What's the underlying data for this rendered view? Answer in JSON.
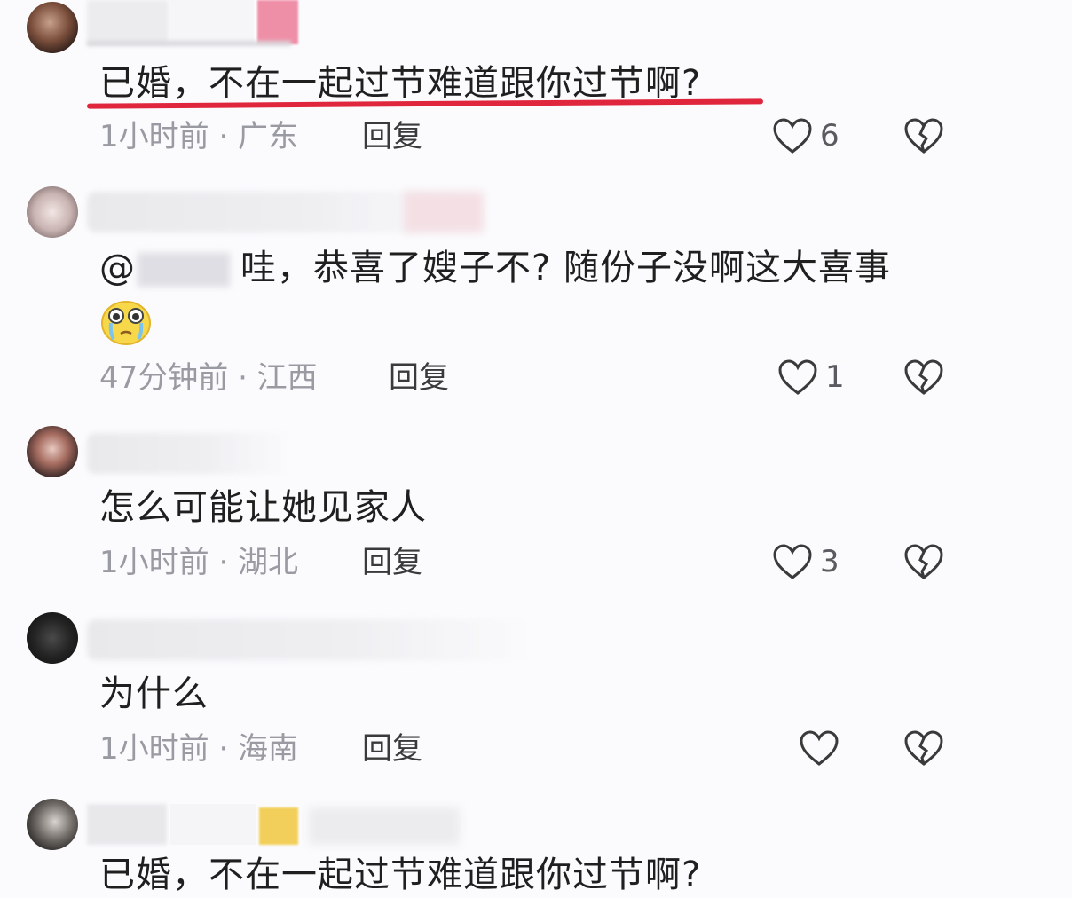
{
  "comments": [
    {
      "text": "已婚，不在一起过节难道跟你过节啊?",
      "time_location": "1小时前 · 广东",
      "reply_label": "回复",
      "likes": "6"
    },
    {
      "mention": "@",
      "text": "哇，恭喜了嫂子不? 随份子没啊这大喜事",
      "time_location": "47分钟前 · 江西",
      "reply_label": "回复",
      "likes": "1"
    },
    {
      "text": "怎么可能让她见家人",
      "time_location": "1小时前 · 湖北",
      "reply_label": "回复",
      "likes": "3"
    },
    {
      "text": "为什么",
      "time_location": "1小时前 · 海南",
      "reply_label": "回复",
      "likes": ""
    },
    {
      "text": "已婚，不在一起过节难道跟你过节啊?"
    }
  ],
  "colors": {
    "highlight_underline": "#e0263d",
    "meta_text": "#9a9aa2",
    "body_text": "#1f1f1f"
  },
  "icons": {
    "like": "heart-outline-icon",
    "dislike": "broken-heart-icon",
    "emoji": "crying-face-emoji"
  }
}
